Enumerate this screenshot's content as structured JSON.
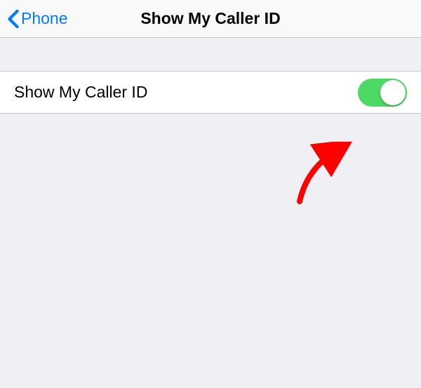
{
  "navbar": {
    "back_label": "Phone",
    "title": "Show My Caller ID"
  },
  "settings": {
    "caller_id": {
      "label": "Show My Caller ID",
      "enabled": true
    }
  },
  "colors": {
    "link": "#007aff",
    "toggle_on": "#4cd964",
    "background": "#efeff4",
    "annotation": "#ff0000"
  }
}
